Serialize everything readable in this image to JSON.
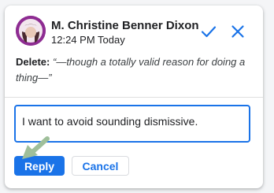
{
  "comment": {
    "author": "M. Christine Benner Dixon",
    "time": "12:24 PM Today",
    "suggestion_label": "Delete:",
    "suggestion_text": "“—though a totally valid reason for doing a thing—”"
  },
  "reply": {
    "value": "I want to avoid sounding dismissive.",
    "reply_label": "Reply",
    "cancel_label": "Cancel"
  },
  "icons": {
    "accept": "check-icon",
    "reject": "close-icon",
    "pointer": "arrow-icon"
  },
  "colors": {
    "accent": "#1a73e8",
    "avatar_bg": "#8e2c92",
    "arrow": "#9fbf9a"
  }
}
